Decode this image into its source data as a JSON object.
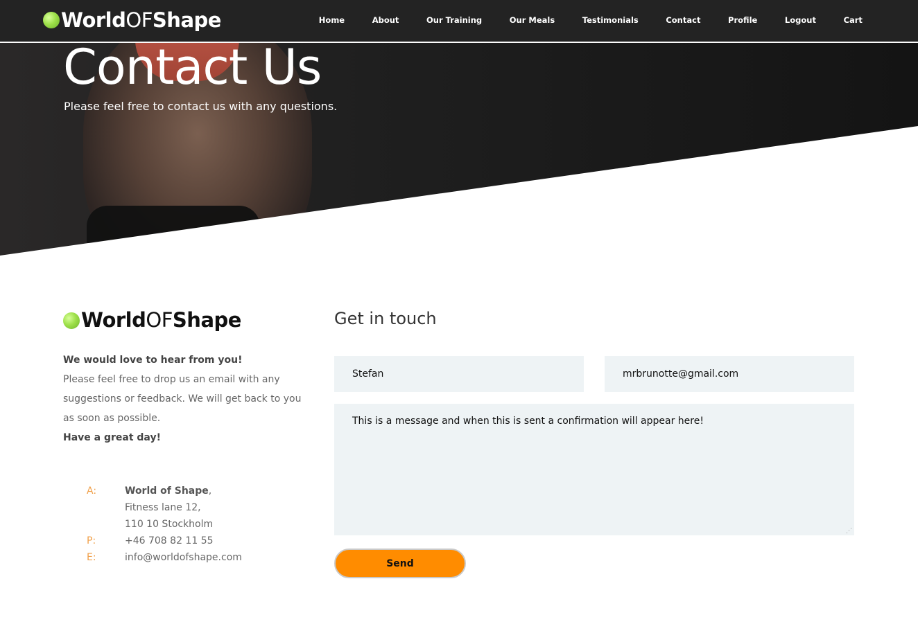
{
  "brand": {
    "part1": "World",
    "part2": "OF",
    "part3": "Shape"
  },
  "nav": {
    "items": [
      {
        "label": "Home"
      },
      {
        "label": "About"
      },
      {
        "label": "Our Training"
      },
      {
        "label": "Our Meals"
      },
      {
        "label": "Testimonials"
      },
      {
        "label": "Contact"
      },
      {
        "label": "Profile"
      },
      {
        "label": "Logout"
      },
      {
        "label": "Cart"
      }
    ]
  },
  "hero": {
    "title": "Contact Us",
    "subtitle": "Please feel free to contact us with any questions."
  },
  "info": {
    "lead_bold": "We would love to hear from you!",
    "lead_text": "Please feel free to drop us an email with any suggestions or feedback. We will get back to you as soon as possible.",
    "closing": "Have a great day!",
    "address": {
      "a_key": "A:",
      "company": "World of Shape",
      "company_suffix": ",",
      "street": "Fitness lane 12,",
      "city": "110 10 Stockholm",
      "p_key": "P:",
      "phone": "+46 708 82 11 55",
      "e_key": "E:",
      "email": "info@worldofshape.com"
    }
  },
  "form": {
    "title": "Get in touch",
    "name_value": "Stefan",
    "email_value": "mrbrunotte@gmail.com",
    "message_value": "This is a message and when this is sent a confirmation will appear here!",
    "send_label": "Send"
  },
  "colors": {
    "accent": "#ff8c00",
    "nav_bg": "#232323",
    "field_bg": "#eef3f5",
    "address_key": "#f0a04a",
    "logo_ball": "#9ee04a"
  }
}
